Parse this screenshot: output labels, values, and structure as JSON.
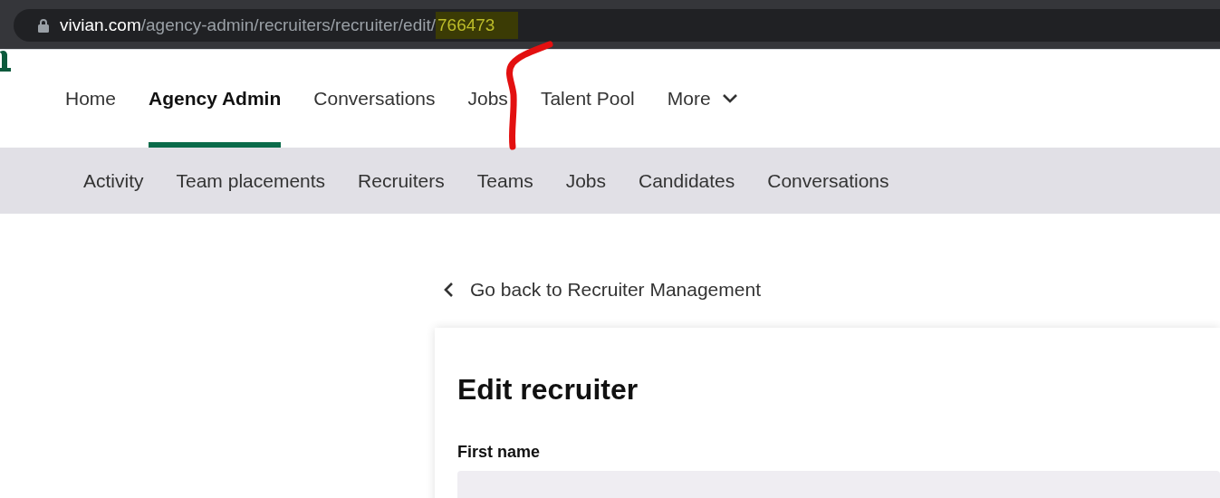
{
  "address_bar": {
    "host": "vivian.com",
    "path": "/agency-admin/recruiters/recruiter/edit/",
    "highlighted_id": "766473"
  },
  "main_nav": [
    {
      "label": "Home",
      "selected": false
    },
    {
      "label": "Agency Admin",
      "selected": true
    },
    {
      "label": "Conversations",
      "selected": false
    },
    {
      "label": "Jobs",
      "selected": false
    },
    {
      "label": "Talent Pool",
      "selected": false
    },
    {
      "label": "More",
      "selected": false,
      "kind": "dropdown"
    }
  ],
  "sub_nav": [
    {
      "label": "Activity"
    },
    {
      "label": "Team placements"
    },
    {
      "label": "Recruiters"
    },
    {
      "label": "Teams"
    },
    {
      "label": "Jobs"
    },
    {
      "label": "Candidates"
    },
    {
      "label": "Conversations"
    }
  ],
  "back_link": "Go back to Recruiter Management",
  "form": {
    "title": "Edit recruiter",
    "fields": [
      {
        "label": "First name"
      }
    ]
  }
}
